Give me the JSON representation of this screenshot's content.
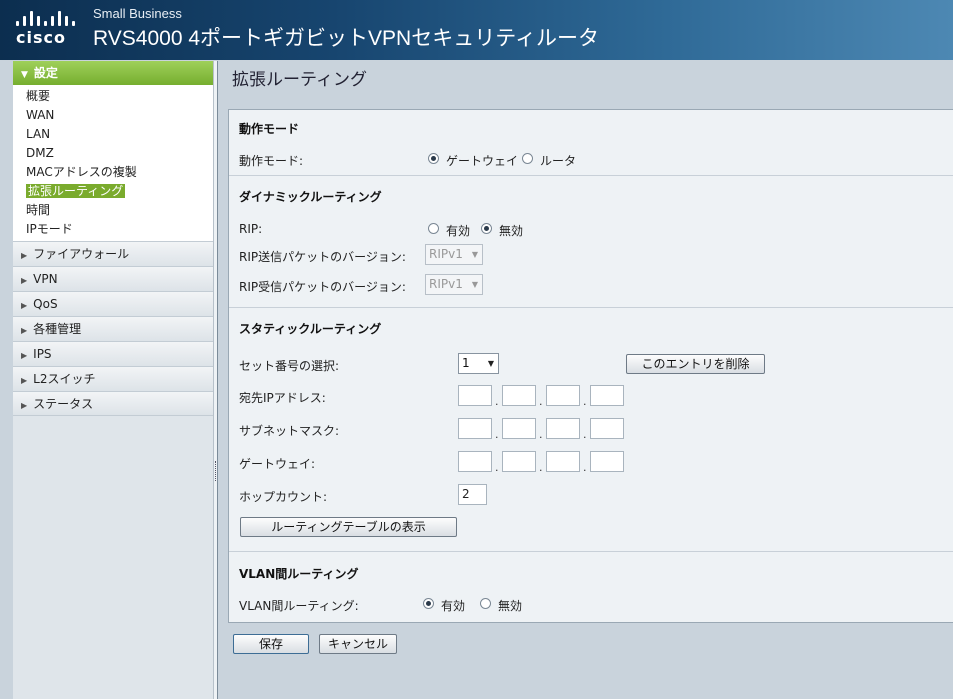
{
  "header": {
    "logo_text": "cisco",
    "subtitle": "Small Business",
    "title": "RVS4000 4ポートギガビットVPNセキュリティルータ"
  },
  "sidebar": {
    "active_section": "設定",
    "sub_items": [
      "概要",
      "WAN",
      "LAN",
      "DMZ",
      "MACアドレスの複製",
      "拡張ルーティング",
      "時間",
      "IPモード"
    ],
    "current_sub_item": "拡張ルーティング",
    "sections": [
      "ファイアウォール",
      "VPN",
      "QoS",
      "各種管理",
      "IPS",
      "L2スイッチ",
      "ステータス"
    ]
  },
  "main": {
    "page_title": "拡張ルーティング",
    "operation_mode": {
      "heading": "動作モード",
      "label": "動作モード:",
      "options": [
        "ゲートウェイ",
        "ルータ"
      ],
      "selected": "ゲートウェイ"
    },
    "dynamic_routing": {
      "heading": "ダイナミックルーティング",
      "rip_label": "RIP:",
      "rip_options": [
        "有効",
        "無効"
      ],
      "rip_selected": "無効",
      "send_version_label": "RIP送信パケットのバージョン:",
      "send_version_value": "RIPv1",
      "recv_version_label": "RIP受信パケットのバージョン:",
      "recv_version_value": "RIPv1"
    },
    "static_routing": {
      "heading": "スタティックルーティング",
      "set_number_label": "セット番号の選択:",
      "set_number_value": "1",
      "delete_entry_button": "このエントリを削除",
      "dest_ip_label": "宛先IPアドレス:",
      "subnet_mask_label": "サブネットマスク:",
      "gateway_label": "ゲートウェイ:",
      "hop_count_label": "ホップカウント:",
      "hop_count_value": "2",
      "show_table_button": "ルーティングテーブルの表示"
    },
    "inter_vlan": {
      "heading": "VLAN間ルーティング",
      "label": "VLAN間ルーティング:",
      "options": [
        "有効",
        "無効"
      ],
      "selected": "有効"
    },
    "save_button": "保存",
    "cancel_button": "キャンセル"
  },
  "colors": {
    "header_dark": "#0c2e4f",
    "nav_active": "#8bc34a",
    "panel_bg": "#eef2f5",
    "page_bg": "#c9d3dc"
  }
}
